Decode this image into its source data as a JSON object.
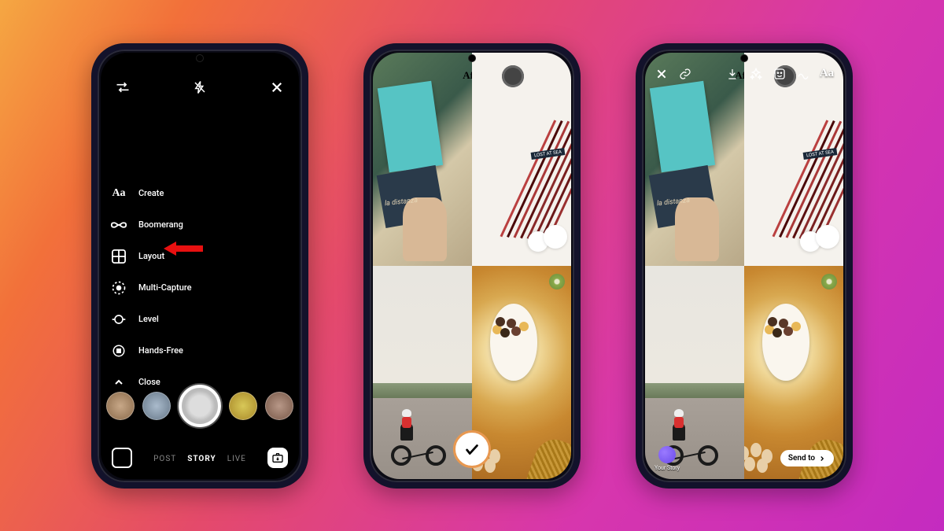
{
  "phone1": {
    "menu": [
      {
        "icon": "Aa",
        "label": "Create"
      },
      {
        "icon": "infinity",
        "label": "Boomerang"
      },
      {
        "icon": "layout",
        "label": "Layout"
      },
      {
        "icon": "multicap",
        "label": "Multi-Capture"
      },
      {
        "icon": "level",
        "label": "Level"
      },
      {
        "icon": "handsfree",
        "label": "Hands-Free"
      },
      {
        "icon": "chevup",
        "label": "Close"
      }
    ],
    "tabs": {
      "post": "POST",
      "story": "STORY",
      "live": "LIVE"
    }
  },
  "phone2": {
    "cells_aff_text": "Aff",
    "lost_label": "LOST AT SEA"
  },
  "phone3": {
    "aa_label": "Aa",
    "your_story": "Your Story",
    "send_to": "Send to"
  }
}
